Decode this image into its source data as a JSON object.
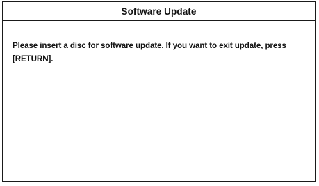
{
  "dialog": {
    "title": "Software Update",
    "message": "Please insert a disc for software update. If you want to exit update, press [RETURN]."
  }
}
